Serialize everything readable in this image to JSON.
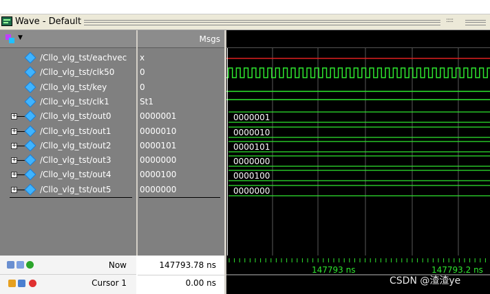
{
  "window": {
    "title": "Wave - Default",
    "dots": ":::::",
    "chevron": "⌄"
  },
  "columns": {
    "msgs_header": "Msgs"
  },
  "signals": [
    {
      "name": "/Cllo_vlg_tst/eachvec",
      "value": "x",
      "expandable": false
    },
    {
      "name": "/Cllo_vlg_tst/clk50",
      "value": "0",
      "expandable": false
    },
    {
      "name": "/Cllo_vlg_tst/key",
      "value": "0",
      "expandable": false
    },
    {
      "name": "/Cllo_vlg_tst/clk1",
      "value": "St1",
      "expandable": false
    },
    {
      "name": "/Cllo_vlg_tst/out0",
      "value": "0000001",
      "expandable": true,
      "bus_label": "0000001"
    },
    {
      "name": "/Cllo_vlg_tst/out1",
      "value": "0000010",
      "expandable": true,
      "bus_label": "0000010"
    },
    {
      "name": "/Cllo_vlg_tst/out2",
      "value": "0000101",
      "expandable": true,
      "bus_label": "0000101"
    },
    {
      "name": "/Cllo_vlg_tst/out3",
      "value": "0000000",
      "expandable": true,
      "bus_label": "0000000"
    },
    {
      "name": "/Cllo_vlg_tst/out4",
      "value": "0000100",
      "expandable": true,
      "bus_label": "0000100"
    },
    {
      "name": "/Cllo_vlg_tst/out5",
      "value": "0000000",
      "expandable": true,
      "bus_label": "0000000"
    }
  ],
  "footer": {
    "now_label": "Now",
    "now_value": "147793.78 ns",
    "cursor_label": "Cursor 1",
    "cursor_value": "0.00 ns"
  },
  "timeline": {
    "labels": [
      "147793 ns",
      "147793.2 ns"
    ]
  },
  "colors": {
    "wave_green": "#2fe82f",
    "x_red": "#e02020",
    "cursor_white": "#ffffff",
    "grid": "#5a5a5a"
  },
  "watermark": "CSDN @渣渣ye",
  "icons": {
    "window": "wave-window-icon",
    "header": "wave-add-icon",
    "plus": "expand-plus-icon",
    "signal": "signal-diamond-icon"
  }
}
